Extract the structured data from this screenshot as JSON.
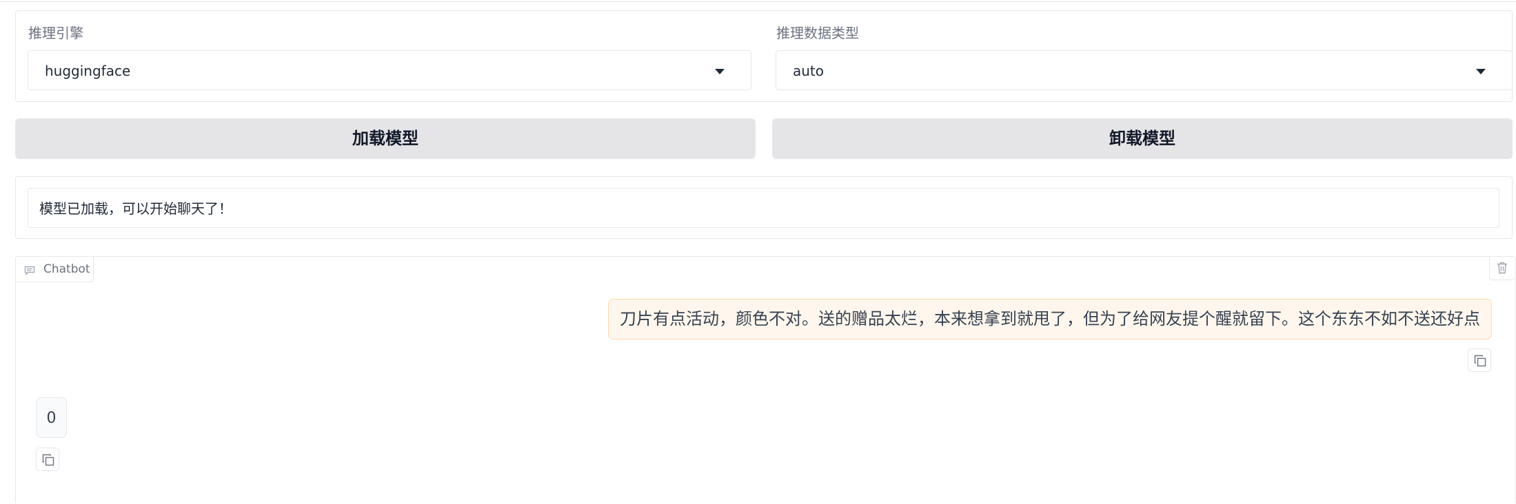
{
  "engine": {
    "label": "推理引擎",
    "selected": "huggingface"
  },
  "dtype": {
    "label": "推理数据类型",
    "selected": "auto"
  },
  "actions": {
    "load_label": "加载模型",
    "unload_label": "卸载模型"
  },
  "status": {
    "text": "模型已加载，可以开始聊天了！"
  },
  "chatbot": {
    "tab_label": "Chatbot",
    "messages": [
      {
        "role": "user",
        "text": "刀片有点活动，颜色不对。送的赠品太烂，本来想拿到就甩了，但为了给网友提个醒就留下。这个东东不如不送还好点"
      },
      {
        "role": "assistant",
        "text": "0"
      }
    ]
  },
  "icons": {
    "dropdown": "chevron-down-icon",
    "chat": "chat-bubble-icon",
    "clear": "trash-icon",
    "copy": "copy-icon"
  },
  "colors": {
    "button_bg": "#e5e5e7",
    "user_bubble_bg": "#fff7ed",
    "user_bubble_border": "#fed7aa",
    "border": "#e5e7eb"
  }
}
